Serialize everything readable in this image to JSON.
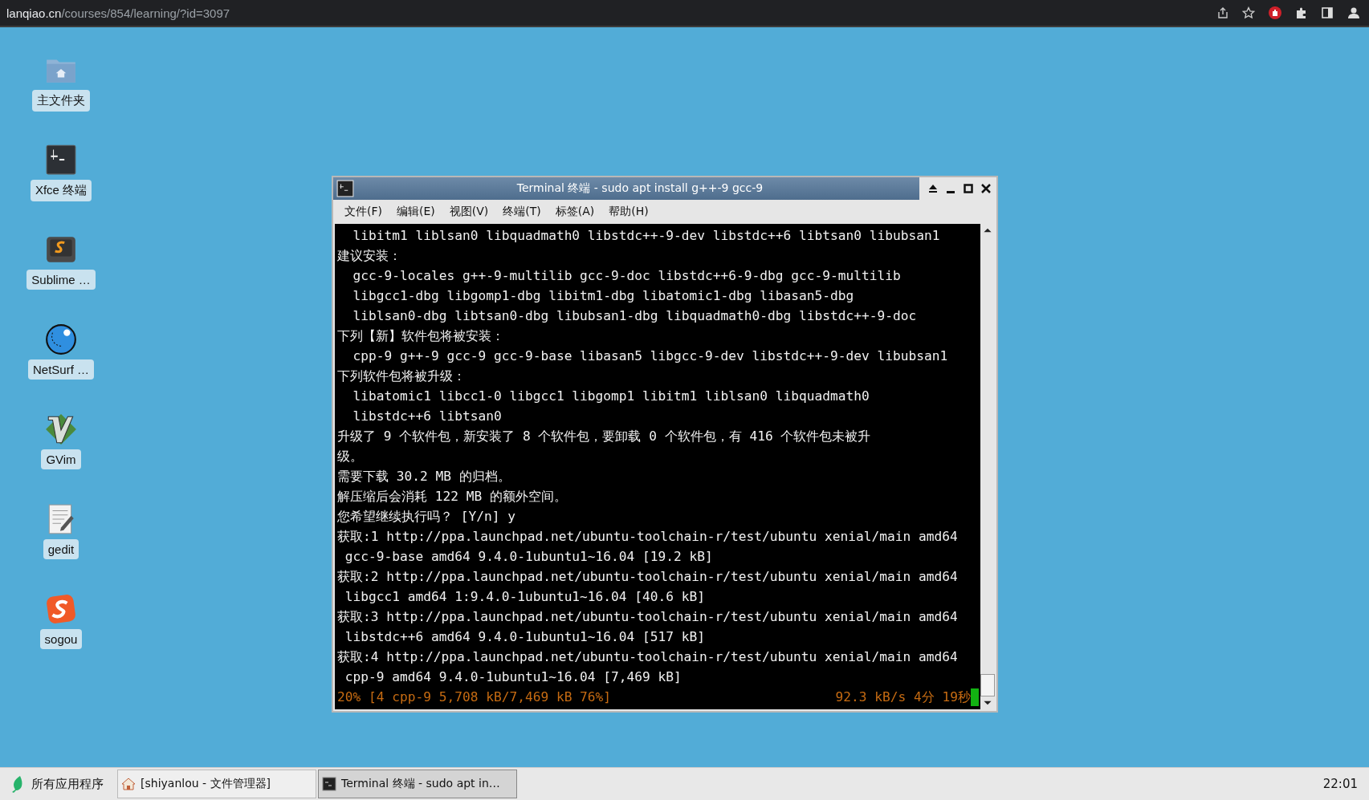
{
  "browser": {
    "url_host": "lanqiao.cn",
    "url_path": "/courses/854/learning/?id=3097"
  },
  "desktop_icons": [
    {
      "kind": "folder",
      "label": "主文件夹"
    },
    {
      "kind": "terminal",
      "label": "Xfce 终端"
    },
    {
      "kind": "sublime",
      "label": "Sublime …"
    },
    {
      "kind": "globe",
      "label": "NetSurf …"
    },
    {
      "kind": "vim",
      "label": "GVim"
    },
    {
      "kind": "gedit",
      "label": "gedit"
    },
    {
      "kind": "sogou",
      "label": "sogou"
    }
  ],
  "terminal": {
    "title": "Terminal 终端 - sudo apt install g++-9 gcc-9",
    "menu": [
      "文件(F)",
      "编辑(E)",
      "视图(V)",
      "终端(T)",
      "标签(A)",
      "帮助(H)"
    ],
    "lines": [
      "  libitm1 liblsan0 libquadmath0 libstdc++-9-dev libstdc++6 libtsan0 libubsan1",
      "建议安装：",
      "  gcc-9-locales g++-9-multilib gcc-9-doc libstdc++6-9-dbg gcc-9-multilib",
      "  libgcc1-dbg libgomp1-dbg libitm1-dbg libatomic1-dbg libasan5-dbg",
      "  liblsan0-dbg libtsan0-dbg libubsan1-dbg libquadmath0-dbg libstdc++-9-doc",
      "下列【新】软件包将被安装：",
      "  cpp-9 g++-9 gcc-9 gcc-9-base libasan5 libgcc-9-dev libstdc++-9-dev libubsan1",
      "下列软件包将被升级：",
      "  libatomic1 libcc1-0 libgcc1 libgomp1 libitm1 liblsan0 libquadmath0",
      "  libstdc++6 libtsan0",
      "升级了 9 个软件包，新安装了 8 个软件包，要卸载 0 个软件包，有 416 个软件包未被升",
      "级。",
      "需要下载 30.2 MB 的归档。",
      "解压缩后会消耗 122 MB 的额外空间。",
      "您希望继续执行吗？ [Y/n] y",
      "获取:1 http://ppa.launchpad.net/ubuntu-toolchain-r/test/ubuntu xenial/main amd64",
      " gcc-9-base amd64 9.4.0-1ubuntu1~16.04 [19.2 kB]",
      "获取:2 http://ppa.launchpad.net/ubuntu-toolchain-r/test/ubuntu xenial/main amd64",
      " libgcc1 amd64 1:9.4.0-1ubuntu1~16.04 [40.6 kB]",
      "获取:3 http://ppa.launchpad.net/ubuntu-toolchain-r/test/ubuntu xenial/main amd64",
      " libstdc++6 amd64 9.4.0-1ubuntu1~16.04 [517 kB]",
      "获取:4 http://ppa.launchpad.net/ubuntu-toolchain-r/test/ubuntu xenial/main amd64",
      " cpp-9 amd64 9.4.0-1ubuntu1~16.04 [7,469 kB]"
    ],
    "progress_left": "20% [4 cpp-9 5,708 kB/7,469 kB 76%]",
    "progress_right": "92.3 kB/s 4分 19秒"
  },
  "taskbar": {
    "start": "所有应用程序",
    "tasks": [
      {
        "kind": "home",
        "label": "[shiyanlou - 文件管理器]",
        "selected": false
      },
      {
        "kind": "terminal",
        "label": "Terminal 终端 - sudo apt in…",
        "selected": true
      }
    ],
    "clock": "22:01"
  }
}
